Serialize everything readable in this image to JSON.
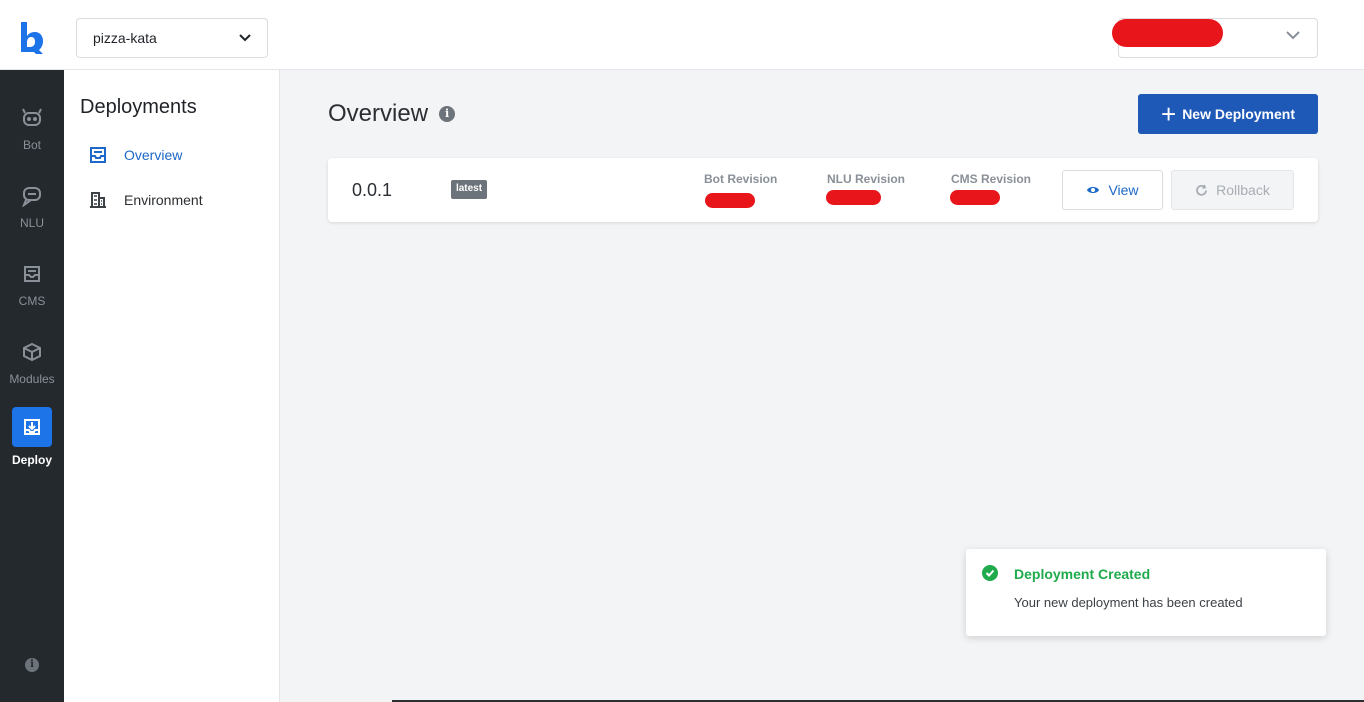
{
  "header": {
    "project_value": "pizza-kata",
    "user_value": ""
  },
  "rail": {
    "items": [
      {
        "label": "Bot",
        "icon": "bot-icon"
      },
      {
        "label": "NLU",
        "icon": "nlu-icon"
      },
      {
        "label": "CMS",
        "icon": "cms-icon"
      },
      {
        "label": "Modules",
        "icon": "modules-icon"
      },
      {
        "label": "Deploy",
        "icon": "deploy-icon"
      }
    ],
    "info_glyph": "i"
  },
  "subnav": {
    "title": "Deployments",
    "items": [
      {
        "label": "Overview",
        "icon": "overview-icon"
      },
      {
        "label": "Environment",
        "icon": "environment-icon"
      }
    ]
  },
  "main": {
    "title": "Overview",
    "info_glyph": "i",
    "new_button_label": "New Deployment",
    "deployment": {
      "version": "0.0.1",
      "badge": "latest",
      "bot_revision_label": "Bot Revision",
      "nlu_revision_label": "NLU Revision",
      "cms_revision_label": "CMS Revision",
      "view_label": "View",
      "rollback_label": "Rollback"
    }
  },
  "toast": {
    "title": "Deployment Created",
    "message": "Your new deployment has been created"
  },
  "colors": {
    "accent": "#1d73e8",
    "primary_button": "#1f59b7",
    "success": "#1faa4c",
    "rail_bg": "#24292e",
    "redaction": "#e8161b"
  }
}
